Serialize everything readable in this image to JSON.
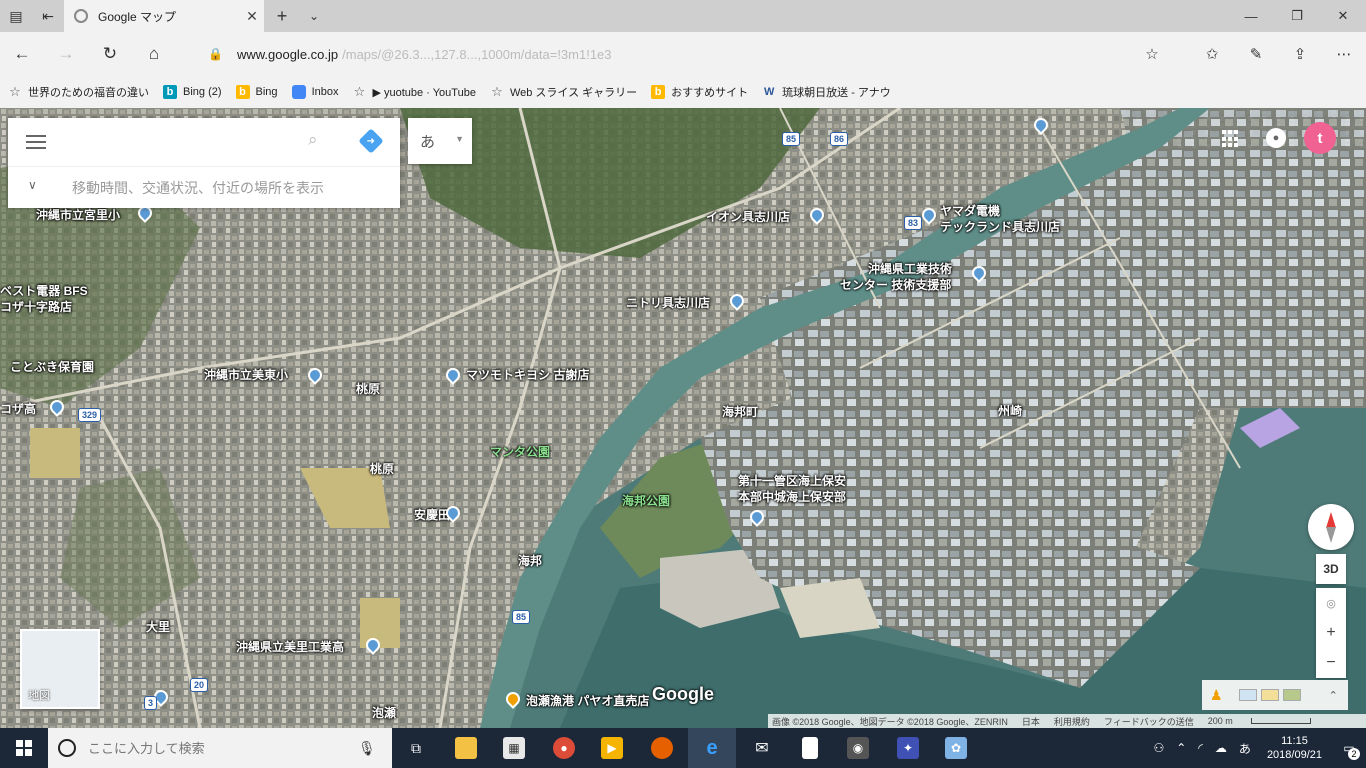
{
  "browser": {
    "tab_title": "Google マップ",
    "url_main": "www.google.co.jp",
    "url_rest": "/maps/@26.3...,127.8...,1000m/data=!3m1!1e3"
  },
  "favorites": [
    {
      "icon": "star",
      "label": "世界のための福音の違い"
    },
    {
      "icon": "bing",
      "label": "Bing (2)"
    },
    {
      "icon": "bingy",
      "label": "Bing"
    },
    {
      "icon": "inbox",
      "label": "Inbox"
    },
    {
      "icon": "star",
      "label": "▶ yuotube · YouTube"
    },
    {
      "icon": "star",
      "label": "Web スライス ギャラリー"
    },
    {
      "icon": "bingy",
      "label": "おすすめサイト"
    },
    {
      "icon": "w",
      "label": "琉球朝日放送 - アナウ"
    }
  ],
  "map": {
    "search_placeholder": "",
    "traffic_text": "移動時間、交通状況、付近の場所を表示",
    "ime_char": "あ",
    "avatar_letter": "t",
    "minimap_label": "地図",
    "google_logo": "Google",
    "btn_3d": "3D",
    "zoom_in": "+",
    "zoom_out": "−",
    "attribution": {
      "imagery": "画像 ©2018 Google、地図データ ©2018 Google、ZENRIN",
      "country": "日本",
      "terms": "利用規約",
      "feedback": "フィードバックの送信",
      "scale": "200 m"
    },
    "labels": [
      {
        "text": "沖縄市立宮里小"
      },
      {
        "text": "イオン具志川店"
      },
      {
        "text": "ヤマダ電機"
      },
      {
        "text": "テックランド具志川店"
      },
      {
        "text": "沖縄県工業技術"
      },
      {
        "text": "センター 技術支援部"
      },
      {
        "text": "ニトリ具志川店"
      },
      {
        "text": "ベスト電器 BFS"
      },
      {
        "text": "コザ十字路店"
      },
      {
        "text": "ことぶき保育園"
      },
      {
        "text": "沖縄市立美東小"
      },
      {
        "text": "マツモトキヨシ 古謝店"
      },
      {
        "text": "桃原"
      },
      {
        "text": "コザ高"
      },
      {
        "text": "海邦町"
      },
      {
        "text": "州崎"
      },
      {
        "text": "マンタ公園"
      },
      {
        "text": "桃原"
      },
      {
        "text": "第十一管区海上保安"
      },
      {
        "text": "本部中城海上保安部"
      },
      {
        "text": "海邦公園"
      },
      {
        "text": "安慶田"
      },
      {
        "text": "海邦"
      },
      {
        "text": "大里"
      },
      {
        "text": "沖縄県立美里工業高"
      },
      {
        "text": "泡瀬漁港 パヤオ直売店"
      },
      {
        "text": "泡瀬"
      }
    ],
    "shields": [
      "85",
      "86",
      "83",
      "329",
      "85",
      "20",
      "3"
    ]
  },
  "taskbar": {
    "search_placeholder": "ここに入力して検索",
    "time": "11:15",
    "date": "2018/09/21",
    "ime": "あ",
    "notifications": "2"
  }
}
